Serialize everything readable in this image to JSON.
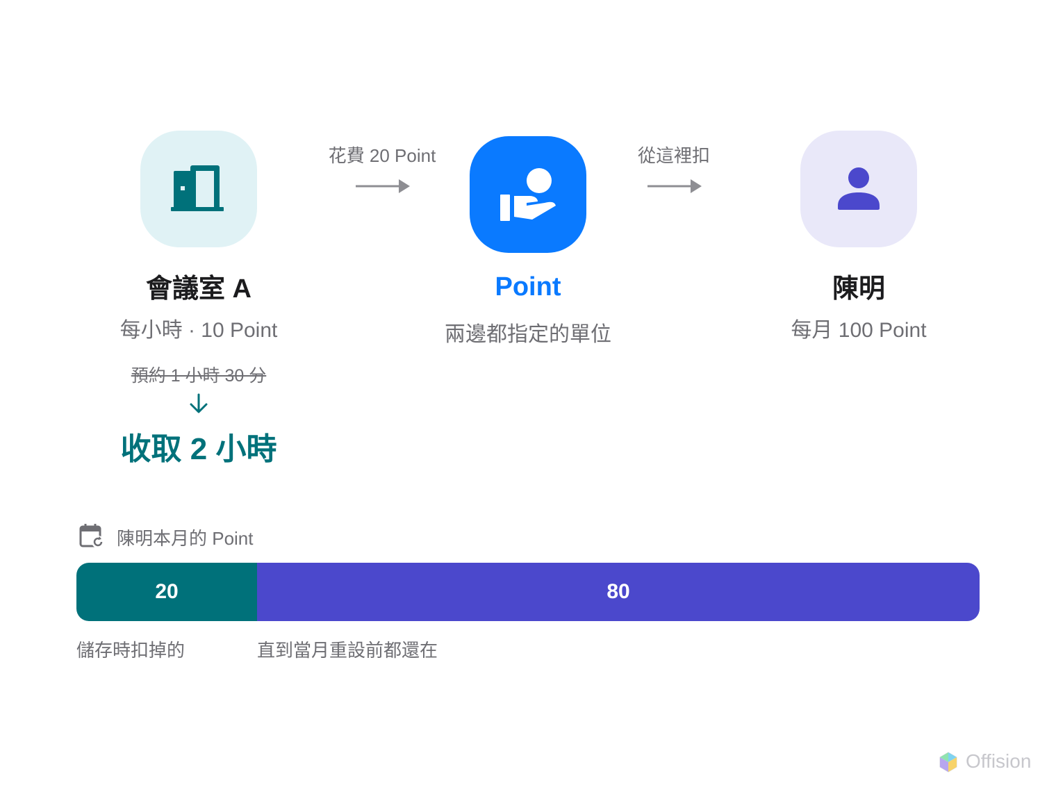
{
  "colors": {
    "room_tile_bg": "#e0f2f5",
    "room_icon": "#00717a",
    "point_tile_bg": "#0a7aff",
    "point_text": "#0a7aff",
    "person_tile_bg": "#e9e8f9",
    "person_icon": "#4b48cc",
    "teal": "#00717a",
    "indigo": "#4b48cc",
    "gray_text": "#6e6e73",
    "arrow": "#8e8e93"
  },
  "icons": {
    "room": "door-icon",
    "point": "hand-coin-icon",
    "person": "person-icon",
    "calendar": "calendar-refresh-icon"
  },
  "flow": {
    "arrow1_label": "花費 20 Point",
    "arrow2_label": "從這裡扣"
  },
  "room": {
    "title": "會議室 A",
    "rate": "每小時 · 10 Point",
    "booked": "預約 1 小時 30 分",
    "charged": "收取 2 小時"
  },
  "point": {
    "title": "Point",
    "subtitle": "兩邊都指定的單位"
  },
  "person": {
    "name": "陳明",
    "quota": "每月 100 Point"
  },
  "balance": {
    "heading": "陳明本月的 Point",
    "total": 100,
    "segments": [
      {
        "value": "20",
        "amount": 20,
        "caption": "儲存時扣掉的",
        "color": "#00717a"
      },
      {
        "value": "80",
        "amount": 80,
        "caption": "直到當月重設前都還在",
        "color": "#4b48cc"
      }
    ]
  },
  "brand": {
    "name": "Offision"
  }
}
